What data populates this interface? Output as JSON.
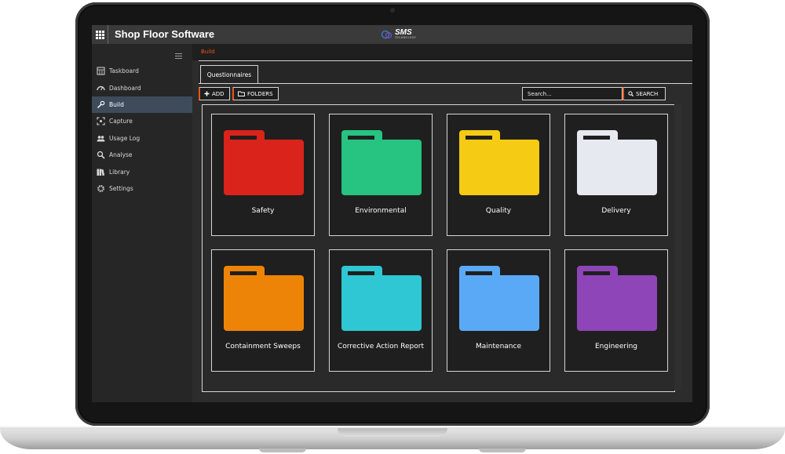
{
  "app": {
    "title": "Shop Floor Software"
  },
  "logo": {
    "name": "SMS",
    "tagline": "TECHNOLOGY"
  },
  "sidebar": {
    "items": [
      {
        "label": "Taskboard",
        "icon": "taskboard-icon"
      },
      {
        "label": "Dashboard",
        "icon": "dashboard-icon"
      },
      {
        "label": "Build",
        "icon": "wrench-icon",
        "active": true
      },
      {
        "label": "Capture",
        "icon": "capture-icon"
      },
      {
        "label": "Usage Log",
        "icon": "users-icon"
      },
      {
        "label": "Analyse",
        "icon": "magnifier-icon"
      },
      {
        "label": "Library",
        "icon": "library-icon"
      },
      {
        "label": "Settings",
        "icon": "gear-icon"
      }
    ]
  },
  "breadcrumb": {
    "current": "Build"
  },
  "tabs": [
    {
      "label": "Questionnaires"
    }
  ],
  "toolbar": {
    "add_label": "ADD",
    "folders_label": "FOLDERS",
    "search_placeholder": "Search...",
    "search_label": "SEARCH"
  },
  "folders": [
    {
      "label": "Safety",
      "color": "#d9231b"
    },
    {
      "label": "Environmental",
      "color": "#26c381"
    },
    {
      "label": "Quality",
      "color": "#f5cb14"
    },
    {
      "label": "Delivery",
      "color": "#e6e9ef"
    },
    {
      "label": "Containment Sweeps",
      "color": "#ee8407"
    },
    {
      "label": "Corrective Action Report",
      "color": "#2ec7d3"
    },
    {
      "label": "Maintenance",
      "color": "#5aa9f7"
    },
    {
      "label": "Engineering",
      "color": "#8e45b8"
    }
  ],
  "colors": {
    "accent": "#e8561e",
    "active_nav": "#3d4b5b"
  }
}
